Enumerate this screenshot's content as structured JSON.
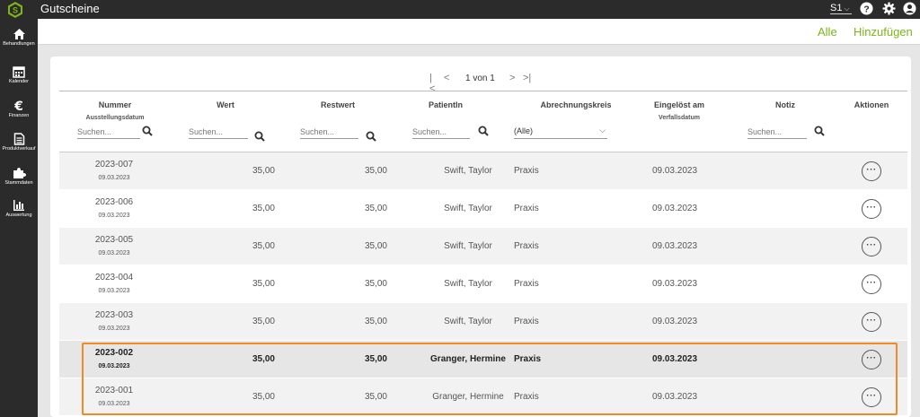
{
  "app": {
    "title": "Gutscheine",
    "workspace": "S1",
    "accent": "#7cb518",
    "highlight_color": "#f08a24"
  },
  "sidebar": {
    "items": [
      {
        "label": "Behandlungen",
        "icon": "home-icon"
      },
      {
        "label": "Kalender",
        "icon": "calendar-icon"
      },
      {
        "label": "Finanzen",
        "icon": "euro-icon"
      },
      {
        "label": "Produktverkauf",
        "icon": "document-icon"
      },
      {
        "label": "Stammdaten",
        "icon": "puzzle-icon"
      },
      {
        "label": "Auswertung",
        "icon": "bar-chart-icon"
      }
    ]
  },
  "actions": {
    "all": "Alle",
    "add": "Hinzufügen"
  },
  "pager": {
    "text": "1 von 1"
  },
  "columns": {
    "nummer": "Nummer",
    "nummer_sub": "Ausstellungsdatum",
    "wert": "Wert",
    "restwert": "Restwert",
    "patient": "PatientIn",
    "kreis": "Abrechnungskreis",
    "eingeloest": "Eingelöst am",
    "eingeloest_sub": "Verfallsdatum",
    "notiz": "Notiz",
    "aktionen": "Aktionen"
  },
  "filters": {
    "search_placeholder": "Suchen...",
    "kreis_value": "(Alle)"
  },
  "rows": [
    {
      "nummer": "2023-007",
      "datum": "09.03.2023",
      "wert": "35,00",
      "restwert": "35,00",
      "patient": "Swift, Taylor",
      "kreis": "Praxis",
      "eingeloest": "09.03.2023"
    },
    {
      "nummer": "2023-006",
      "datum": "09.03.2023",
      "wert": "35,00",
      "restwert": "35,00",
      "patient": "Swift, Taylor",
      "kreis": "Praxis",
      "eingeloest": "09.03.2023"
    },
    {
      "nummer": "2023-005",
      "datum": "09.03.2023",
      "wert": "35,00",
      "restwert": "35,00",
      "patient": "Swift, Taylor",
      "kreis": "Praxis",
      "eingeloest": "09.03.2023"
    },
    {
      "nummer": "2023-004",
      "datum": "09.03.2023",
      "wert": "35,00",
      "restwert": "35,00",
      "patient": "Swift, Taylor",
      "kreis": "Praxis",
      "eingeloest": "09.03.2023"
    },
    {
      "nummer": "2023-003",
      "datum": "09.03.2023",
      "wert": "35,00",
      "restwert": "35,00",
      "patient": "Swift, Taylor",
      "kreis": "Praxis",
      "eingeloest": "09.03.2023"
    },
    {
      "nummer": "2023-002",
      "datum": "09.03.2023",
      "wert": "35,00",
      "restwert": "35,00",
      "patient": "Granger, Hermine",
      "kreis": "Praxis",
      "eingeloest": "09.03.2023"
    },
    {
      "nummer": "2023-001",
      "datum": "09.03.2023",
      "wert": "35,00",
      "restwert": "35,00",
      "patient": "Granger, Hermine",
      "kreis": "Praxis",
      "eingeloest": "09.03.2023"
    }
  ]
}
